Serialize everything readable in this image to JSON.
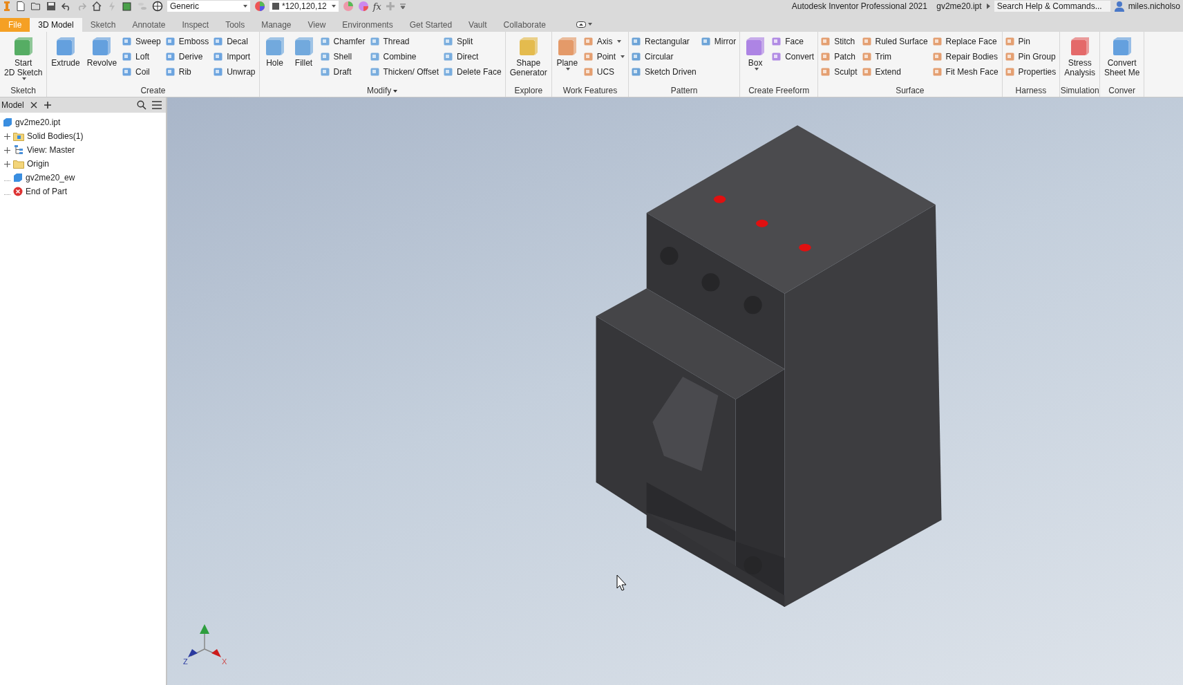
{
  "quick_access": {
    "style_dropdown": "Generic",
    "color_dropdown": "*120,120,12",
    "formula_button": "fx"
  },
  "title": {
    "app": "Autodesk Inventor Professional 2021",
    "file": "gv2me20.ipt"
  },
  "search": {
    "placeholder": "Search Help & Commands..."
  },
  "user": {
    "name": "miles.nicholso"
  },
  "tabs": [
    {
      "label": "File",
      "kind": "app",
      "selected": false
    },
    {
      "label": "3D Model",
      "kind": "tab",
      "selected": true
    },
    {
      "label": "Sketch",
      "kind": "tab",
      "selected": false
    },
    {
      "label": "Annotate",
      "kind": "tab",
      "selected": false
    },
    {
      "label": "Inspect",
      "kind": "tab",
      "selected": false
    },
    {
      "label": "Tools",
      "kind": "tab",
      "selected": false
    },
    {
      "label": "Manage",
      "kind": "tab",
      "selected": false
    },
    {
      "label": "View",
      "kind": "tab",
      "selected": false
    },
    {
      "label": "Environments",
      "kind": "tab",
      "selected": false
    },
    {
      "label": "Get Started",
      "kind": "tab",
      "selected": false
    },
    {
      "label": "Vault",
      "kind": "tab",
      "selected": false
    },
    {
      "label": "Collaborate",
      "kind": "tab",
      "selected": false
    }
  ],
  "ribbon": {
    "panels": [
      {
        "title": "Sketch",
        "menu": false,
        "items": [
          {
            "kind": "large",
            "label": "Start\n2D Sketch",
            "caret": true
          }
        ]
      },
      {
        "title": "Create",
        "menu": false,
        "items": [
          {
            "kind": "large",
            "label": "Extrude",
            "caret": false
          },
          {
            "kind": "large",
            "label": "Revolve",
            "caret": false
          },
          {
            "kind": "column",
            "items": [
              {
                "label": "Sweep",
                "caret": false
              },
              {
                "label": "Loft",
                "caret": false
              },
              {
                "label": "Coil",
                "caret": false
              }
            ]
          },
          {
            "kind": "column",
            "items": [
              {
                "label": "Emboss",
                "caret": false
              },
              {
                "label": "Derive",
                "caret": false
              },
              {
                "label": "Rib",
                "caret": false
              }
            ]
          },
          {
            "kind": "column",
            "items": [
              {
                "label": "Decal",
                "caret": false
              },
              {
                "label": "Import",
                "caret": false
              },
              {
                "label": "Unwrap",
                "caret": false
              }
            ]
          }
        ]
      },
      {
        "title": "Modify",
        "menu": true,
        "items": [
          {
            "kind": "large",
            "label": "Hole",
            "caret": false
          },
          {
            "kind": "large",
            "label": "Fillet",
            "caret": false
          },
          {
            "kind": "column",
            "items": [
              {
                "label": "Chamfer",
                "caret": false
              },
              {
                "label": "Shell",
                "caret": false
              },
              {
                "label": "Draft",
                "caret": false
              }
            ]
          },
          {
            "kind": "column",
            "items": [
              {
                "label": "Thread",
                "caret": false
              },
              {
                "label": "Combine",
                "caret": false
              },
              {
                "label": "Thicken/ Offset",
                "caret": false
              }
            ]
          },
          {
            "kind": "column",
            "items": [
              {
                "label": "Split",
                "caret": false
              },
              {
                "label": "Direct",
                "caret": false
              },
              {
                "label": "Delete Face",
                "caret": false
              }
            ]
          }
        ]
      },
      {
        "title": "Explore",
        "menu": false,
        "items": [
          {
            "kind": "large",
            "label": "Shape\nGenerator",
            "caret": false
          }
        ]
      },
      {
        "title": "Work Features",
        "menu": false,
        "items": [
          {
            "kind": "large",
            "label": "Plane",
            "caret": true
          },
          {
            "kind": "column",
            "items": [
              {
                "label": "Axis",
                "caret": true
              },
              {
                "label": "Point",
                "caret": true
              },
              {
                "label": "UCS",
                "caret": false
              }
            ]
          }
        ]
      },
      {
        "title": "Pattern",
        "menu": false,
        "items": [
          {
            "kind": "column",
            "items": [
              {
                "label": "Rectangular",
                "caret": false
              },
              {
                "label": "Circular",
                "caret": false
              },
              {
                "label": "Sketch Driven",
                "caret": false
              }
            ]
          },
          {
            "kind": "column",
            "items": [
              {
                "label": "Mirror",
                "caret": false
              }
            ]
          }
        ]
      },
      {
        "title": "Create Freeform",
        "menu": false,
        "items": [
          {
            "kind": "large",
            "label": "Box",
            "caret": true
          },
          {
            "kind": "column",
            "items": [
              {
                "label": "Face",
                "caret": false
              },
              {
                "label": "Convert",
                "caret": false
              }
            ]
          }
        ]
      },
      {
        "title": "Surface",
        "menu": false,
        "items": [
          {
            "kind": "column",
            "items": [
              {
                "label": "Stitch",
                "caret": false
              },
              {
                "label": "Patch",
                "caret": false
              },
              {
                "label": "Sculpt",
                "caret": false
              }
            ]
          },
          {
            "kind": "column",
            "items": [
              {
                "label": "Ruled Surface",
                "caret": false
              },
              {
                "label": "Trim",
                "caret": false
              },
              {
                "label": "Extend",
                "caret": false
              }
            ]
          },
          {
            "kind": "column",
            "items": [
              {
                "label": "Replace Face",
                "caret": false
              },
              {
                "label": "Repair Bodies",
                "caret": false
              },
              {
                "label": "Fit Mesh Face",
                "caret": false
              }
            ]
          }
        ]
      },
      {
        "title": "Harness",
        "menu": false,
        "items": [
          {
            "kind": "column",
            "items": [
              {
                "label": "Pin",
                "caret": false
              },
              {
                "label": "Pin Group",
                "caret": false
              },
              {
                "label": "Properties",
                "caret": false
              }
            ]
          }
        ]
      },
      {
        "title": "Simulation",
        "menu": false,
        "items": [
          {
            "kind": "large",
            "label": "Stress\nAnalysis",
            "caret": false
          }
        ]
      },
      {
        "title": "Conver",
        "menu": false,
        "items": [
          {
            "kind": "large",
            "label": "Convert\nSheet Me",
            "caret": false
          }
        ]
      }
    ]
  },
  "browser": {
    "tab": "Model",
    "root": {
      "label": "gv2me20.ipt",
      "children": [
        {
          "label": "Solid Bodies(1)",
          "kind": "bodies-folder",
          "expandable": true
        },
        {
          "label": "View: Master",
          "kind": "view",
          "expandable": true
        },
        {
          "label": "Origin",
          "kind": "folder",
          "expandable": true
        },
        {
          "label": "gv2me20_ew",
          "kind": "body",
          "expandable": false
        },
        {
          "label": "End of Part",
          "kind": "end",
          "expandable": false
        }
      ]
    }
  },
  "viewport": {
    "axis_labels": [
      "Z",
      "X"
    ]
  }
}
